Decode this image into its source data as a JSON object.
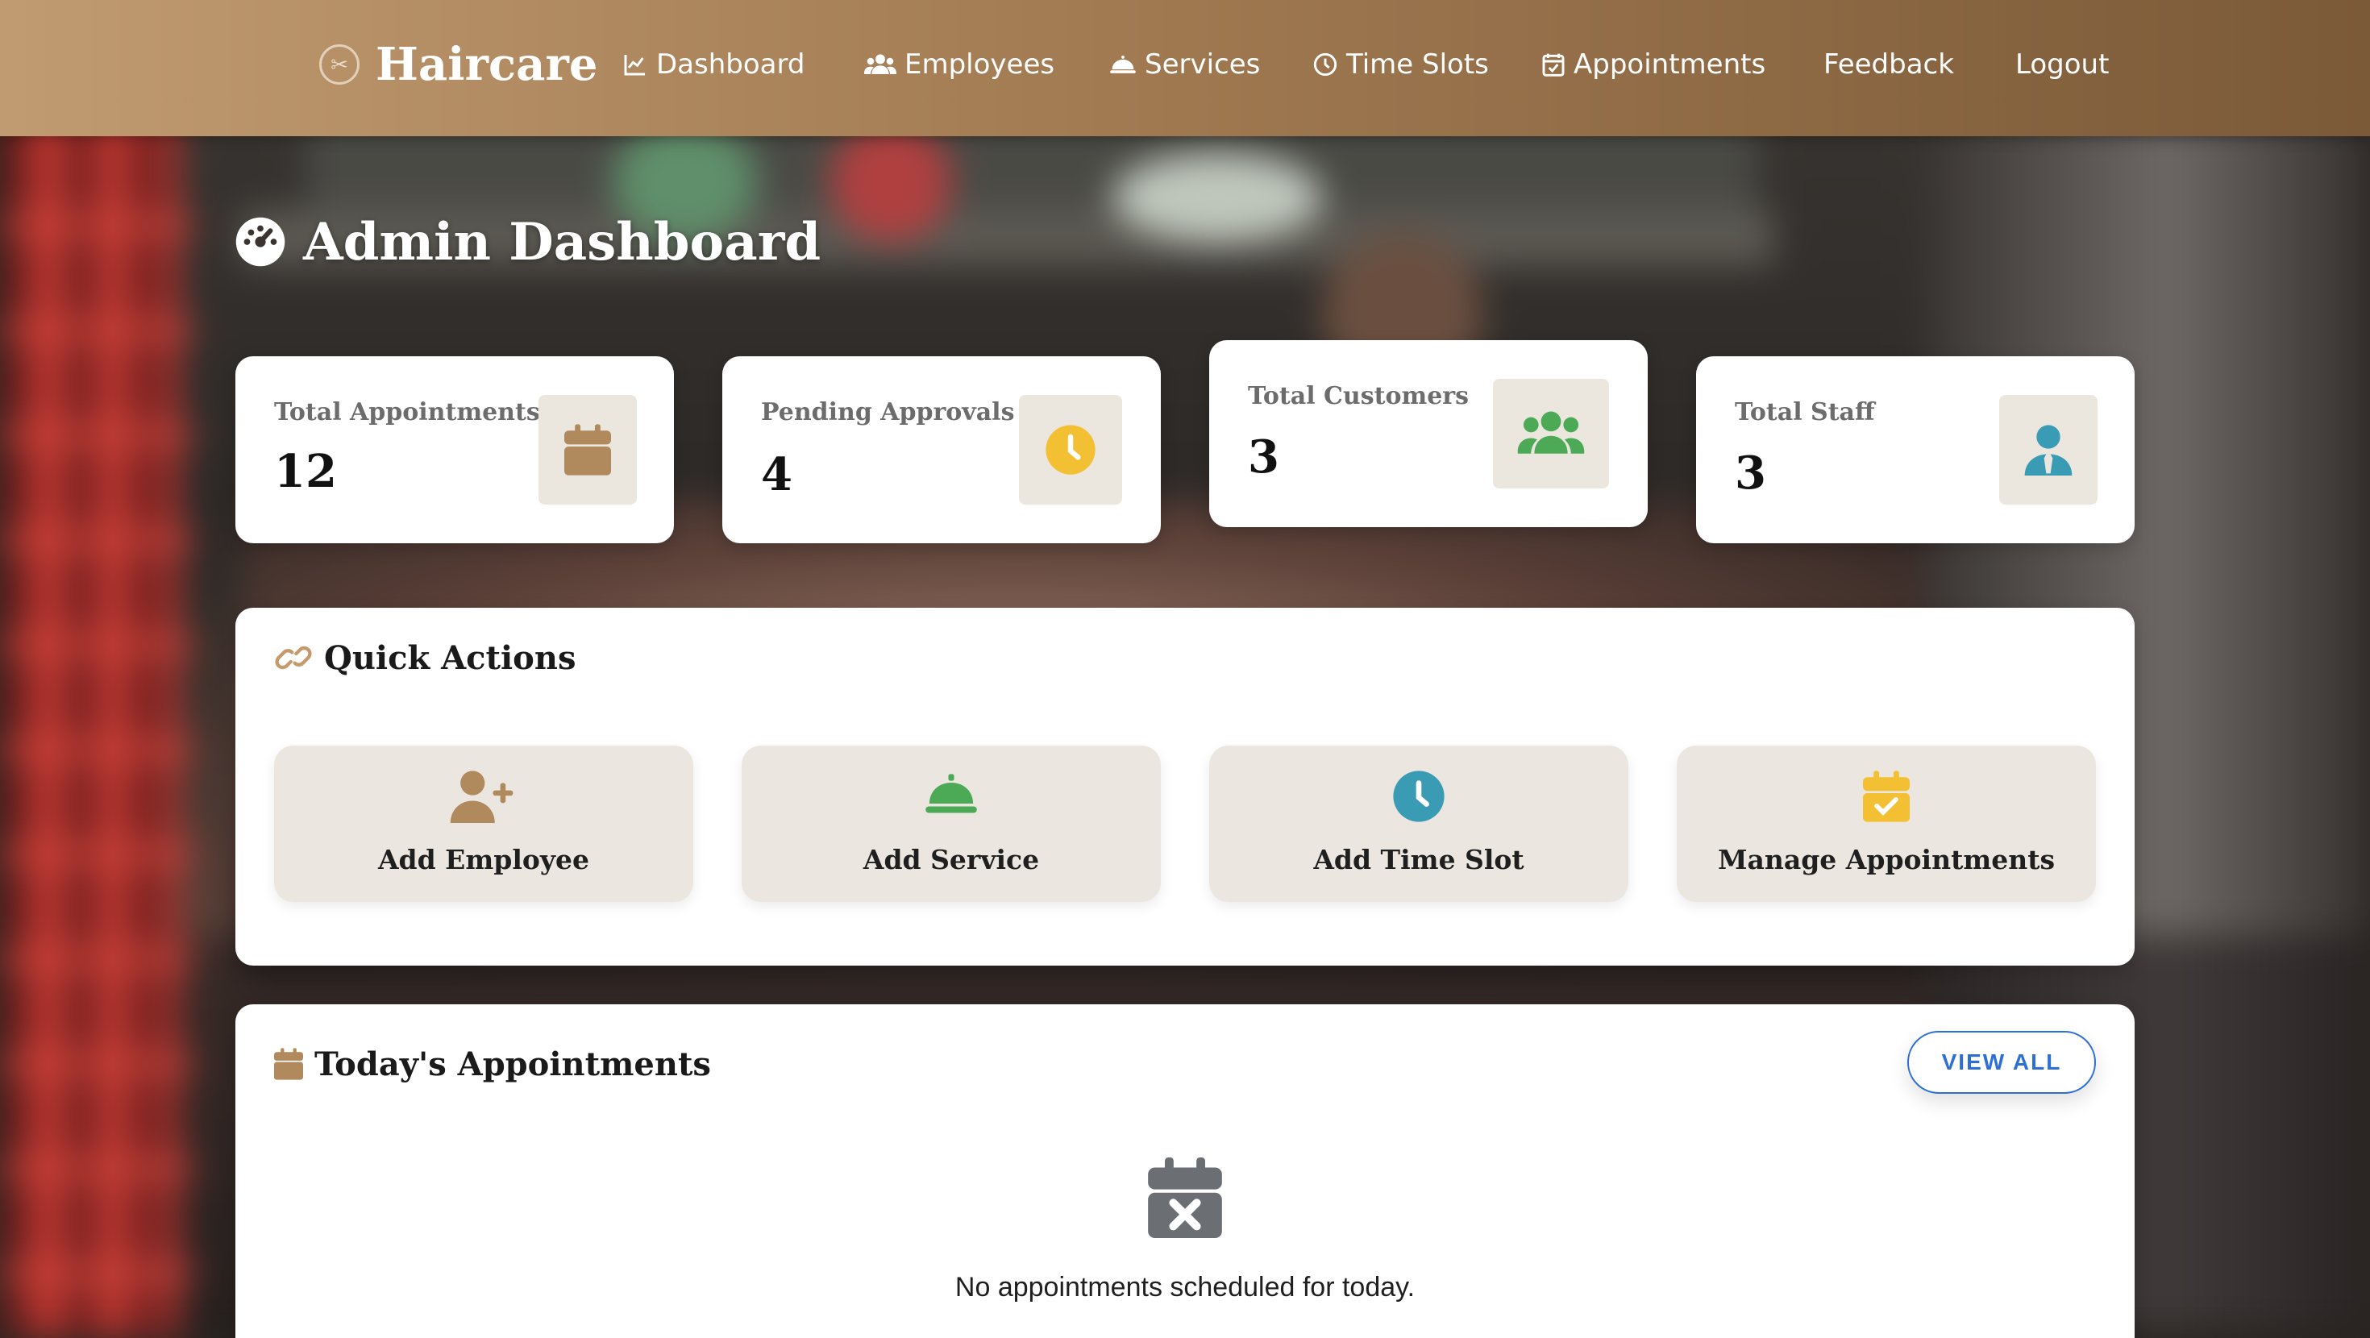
{
  "nav": {
    "brand": "Haircare",
    "items": [
      {
        "label": "Dashboard",
        "icon": "chart-line-icon"
      },
      {
        "label": "Employees",
        "icon": "users-icon"
      },
      {
        "label": "Services",
        "icon": "service-bell-icon"
      },
      {
        "label": "Time Slots",
        "icon": "clock-icon"
      },
      {
        "label": "Appointments",
        "icon": "calendar-check-icon"
      },
      {
        "label": "Feedback"
      },
      {
        "label": "Logout"
      }
    ]
  },
  "page": {
    "title": "Admin Dashboard",
    "title_icon": "gauge-icon"
  },
  "stats": [
    {
      "label": "Total Appointments",
      "value": "12",
      "icon": "calendar-icon",
      "icon_color": "#b08a5c"
    },
    {
      "label": "Pending Approvals",
      "value": "4",
      "icon": "clock-icon",
      "icon_color": "#f4c033"
    },
    {
      "label": "Total Customers",
      "value": "3",
      "icon": "users-icon",
      "icon_color": "#4caa56"
    },
    {
      "label": "Total Staff",
      "value": "3",
      "icon": "user-tie-icon",
      "icon_color": "#3a9bb5"
    }
  ],
  "quick_actions": {
    "title": "Quick Actions",
    "icon": "link-icon",
    "items": [
      {
        "label": "Add Employee",
        "icon": "user-plus-icon",
        "icon_color": "#b08a5c"
      },
      {
        "label": "Add Service",
        "icon": "service-bell-icon",
        "icon_color": "#4caa56"
      },
      {
        "label": "Add Time Slot",
        "icon": "clock-icon",
        "icon_color": "#3a9bb5"
      },
      {
        "label": "Manage Appointments",
        "icon": "calendar-check-icon",
        "icon_color": "#f4c033"
      }
    ]
  },
  "today": {
    "title": "Today's Appointments",
    "icon": "calendar-icon",
    "view_all": "VIEW ALL",
    "empty_text": "No appointments scheduled for today.",
    "empty_icon": "calendar-x-icon"
  },
  "colors": {
    "nav_start": "#c09a70",
    "nav_end": "#7b5a38",
    "accent_blue": "#2e6fd6"
  }
}
